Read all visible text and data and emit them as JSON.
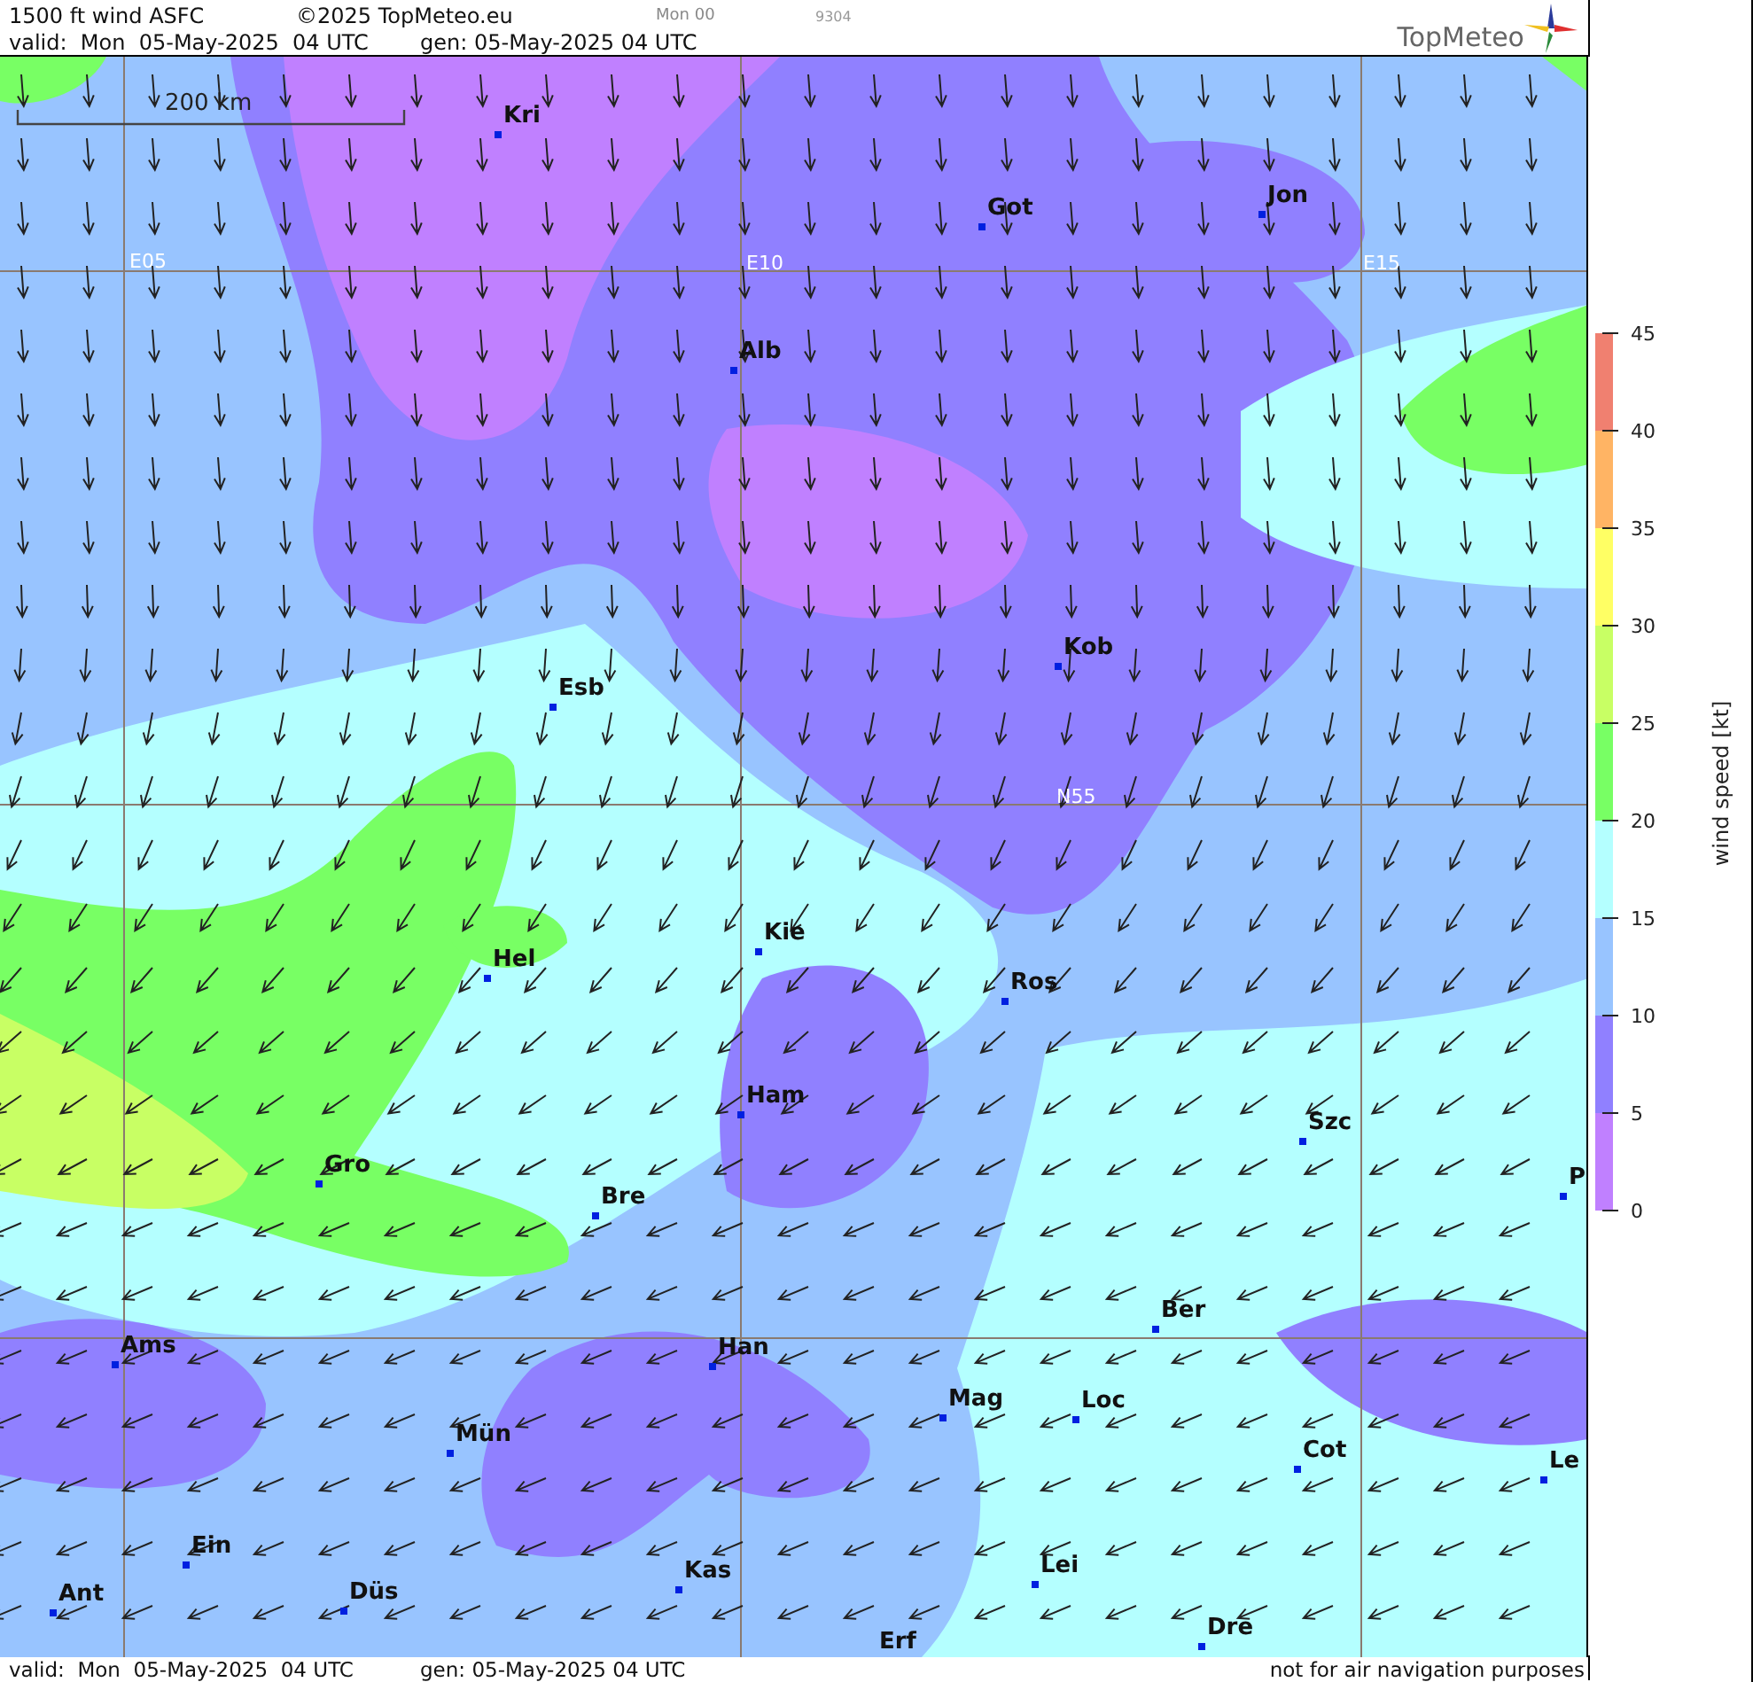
{
  "header": {
    "title": "1500 ft wind ASFC",
    "copyright": "©2025 TopMeteo.eu",
    "run": "Mon 00",
    "code": "9304",
    "valid": "valid:  Mon  05-May-2025  04 UTC",
    "gen": "gen: 05-May-2025 04 UTC",
    "logo": "TopMeteo"
  },
  "map": {
    "scale": "200 km",
    "grid_labels": [
      "E05",
      "E10",
      "E15",
      "N55"
    ],
    "cities": [
      {
        "name": "Kri"
      },
      {
        "name": "Got"
      },
      {
        "name": "Jon"
      },
      {
        "name": "Alb"
      },
      {
        "name": "Kob"
      },
      {
        "name": "Esb"
      },
      {
        "name": "Kie"
      },
      {
        "name": "Hel"
      },
      {
        "name": "Ros"
      },
      {
        "name": "Ham"
      },
      {
        "name": "Szc"
      },
      {
        "name": "Gro"
      },
      {
        "name": "Bre"
      },
      {
        "name": "P"
      },
      {
        "name": "Ber"
      },
      {
        "name": "Ams"
      },
      {
        "name": "Han"
      },
      {
        "name": "Mag"
      },
      {
        "name": "Loc"
      },
      {
        "name": "Mün"
      },
      {
        "name": "Cot"
      },
      {
        "name": "Le"
      },
      {
        "name": "Ein"
      },
      {
        "name": "Kas"
      },
      {
        "name": "Lei"
      },
      {
        "name": "Ant"
      },
      {
        "name": "Düs"
      },
      {
        "name": "Dre"
      },
      {
        "name": "Erf"
      }
    ]
  },
  "legend": {
    "title": "wind speed [kt]",
    "ticks": [
      "45",
      "40",
      "35",
      "30",
      "25",
      "20",
      "15",
      "10",
      "5",
      "0"
    ],
    "bands": [
      {
        "color": "#f08070"
      },
      {
        "color": "#ffb464"
      },
      {
        "color": "#ffff64"
      },
      {
        "color": "#c8ff64"
      },
      {
        "color": "#78ff64"
      },
      {
        "color": "#b4ffff"
      },
      {
        "color": "#98c4ff"
      },
      {
        "color": "#9080ff"
      },
      {
        "color": "#c080ff"
      }
    ]
  },
  "footer": {
    "valid": "valid:  Mon  05-May-2025  04 UTC",
    "gen": "gen: 05-May-2025 04 UTC",
    "disclaimer": "not for air navigation purposes"
  }
}
